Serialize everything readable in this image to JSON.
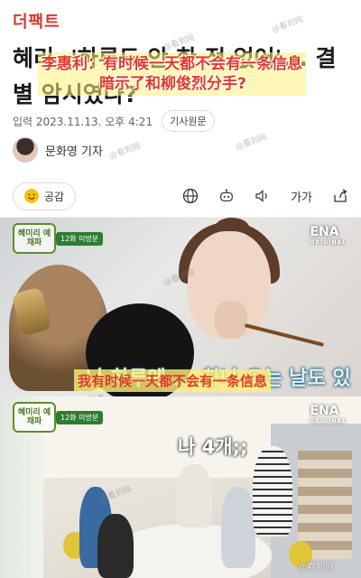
{
  "header": {
    "brand": "더팩트"
  },
  "article": {
    "headline_ko": "혜리, '하루도 안 한 적 없어'... 결별 암시였나?",
    "overlay_cn_line1": "李惠利：有时候一天都不会有一条信息",
    "overlay_cn_line2": "暗示了和柳俊烈分手?",
    "meta": {
      "date": "입력 2023.11.13. 오후 4:21",
      "source_button": "기사원문"
    },
    "author": "문화영 기자"
  },
  "actions": {
    "like_label": "공감",
    "font_size_label": "가가"
  },
  "video1": {
    "logo": "혜미리 예채파",
    "episode_badge": "12화 미방분",
    "broadcaster": "ENA",
    "broadcaster_sub": "ORIGINAL",
    "sub_ko": "나 하루에 ... 하나 오는 날도 있어요",
    "sub_cn": "我有时候一天都不会有一条信息"
  },
  "video2": {
    "logo": "혜미리 예채파",
    "episode_badge": "12화 미방분",
    "broadcaster": "ENA",
    "broadcaster_sub": "ORIGINAL",
    "sub_ko": "나 4개;;",
    "weibo_mark": "@看到网"
  },
  "watermark_text": "@看到网",
  "colors": {
    "brand": "#e0332b",
    "overlay_text": "#e03a2a",
    "overlay_bg": "#fff078"
  }
}
